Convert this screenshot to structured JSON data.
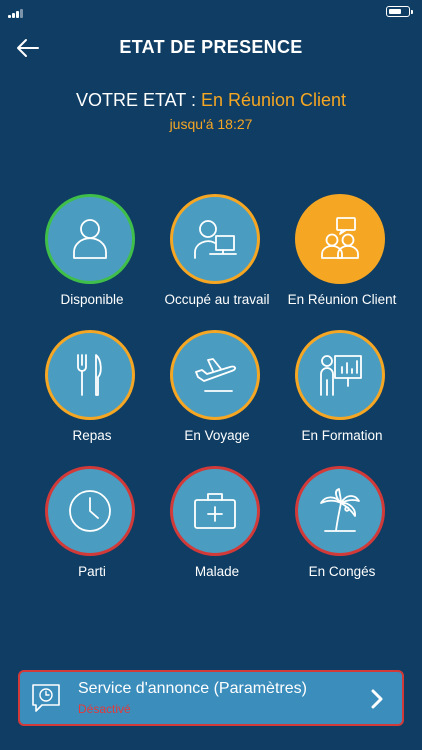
{
  "header": {
    "title": "ETAT DE PRESENCE"
  },
  "state": {
    "label": "VOTRE ETAT : ",
    "value": "En Réunion Client",
    "until": "jusqu'á 18:27"
  },
  "colors": {
    "available": "#3fbf4a",
    "busy": "#f5a623",
    "away": "#d23a3a",
    "selected_fill": "#f5a623",
    "circle_fill": "#4a9dc0"
  },
  "statuses": [
    {
      "label": "Disponible",
      "icon": "person-icon",
      "ring": "available",
      "selected": false
    },
    {
      "label": "Occupé au travail",
      "icon": "person-at-desk-icon",
      "ring": "busy",
      "selected": false
    },
    {
      "label": "En Réunion Client",
      "icon": "meeting-people-icon",
      "ring": "busy",
      "selected": true
    },
    {
      "label": "Repas",
      "icon": "fork-knife-icon",
      "ring": "busy",
      "selected": false
    },
    {
      "label": "En Voyage",
      "icon": "airplane-icon",
      "ring": "busy",
      "selected": false
    },
    {
      "label": "En Formation",
      "icon": "presentation-board-icon",
      "ring": "busy",
      "selected": false
    },
    {
      "label": "Parti",
      "icon": "clock-icon",
      "ring": "away",
      "selected": false
    },
    {
      "label": "Malade",
      "icon": "medical-kit-icon",
      "ring": "away",
      "selected": false
    },
    {
      "label": "En Congés",
      "icon": "palm-tree-icon",
      "ring": "away",
      "selected": false
    }
  ],
  "announcement": {
    "title": "Service d'annonce (Paramètres)",
    "status": "Désactivé",
    "icon": "speech-bubble-clock-icon"
  }
}
